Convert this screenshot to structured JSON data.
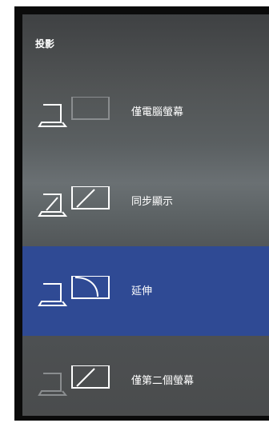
{
  "panel": {
    "title": "投影"
  },
  "options": [
    {
      "label": "僅電腦螢幕",
      "icon": "pc-screen-only-icon",
      "selected": false
    },
    {
      "label": "同步顯示",
      "icon": "duplicate-icon",
      "selected": false
    },
    {
      "label": "延伸",
      "icon": "extend-icon",
      "selected": true
    },
    {
      "label": "僅第二個螢幕",
      "icon": "second-screen-only-icon",
      "selected": false
    }
  ],
  "colors": {
    "selected_background": "#2f4a94",
    "text": "#ffffff",
    "inactive_icon": "#8a8d8f"
  }
}
